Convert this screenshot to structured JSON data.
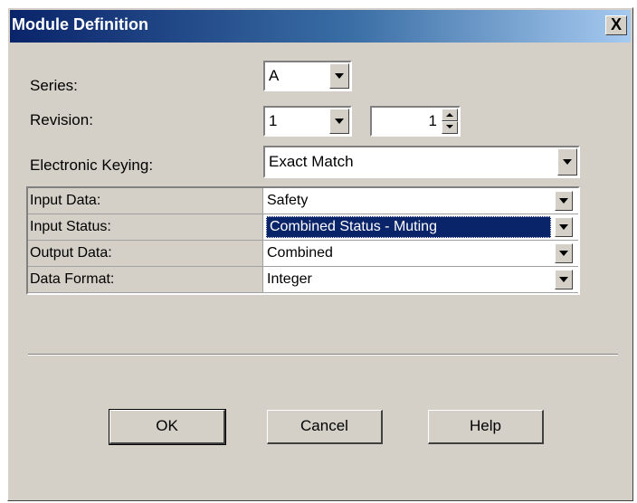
{
  "window": {
    "title": "Module Definition",
    "close_label": "X"
  },
  "series": {
    "label": "Series:",
    "value": "A"
  },
  "revision": {
    "label": "Revision:",
    "major": "1",
    "minor": "1"
  },
  "keying": {
    "label": "Electronic Keying:",
    "value": "Exact Match"
  },
  "grid": {
    "rows": [
      {
        "name": "Input Data:",
        "value": "Safety"
      },
      {
        "name": "Input Status:",
        "value": "Combined Status - Muting"
      },
      {
        "name": "Output Data:",
        "value": "Combined"
      },
      {
        "name": "Data Format:",
        "value": "Integer"
      }
    ]
  },
  "buttons": {
    "ok": "OK",
    "cancel": "Cancel",
    "help": "Help"
  },
  "colors": {
    "title_start": "#0a246a",
    "title_end": "#a6caf0",
    "face": "#d4d0c8",
    "selection": "#0a246a"
  }
}
